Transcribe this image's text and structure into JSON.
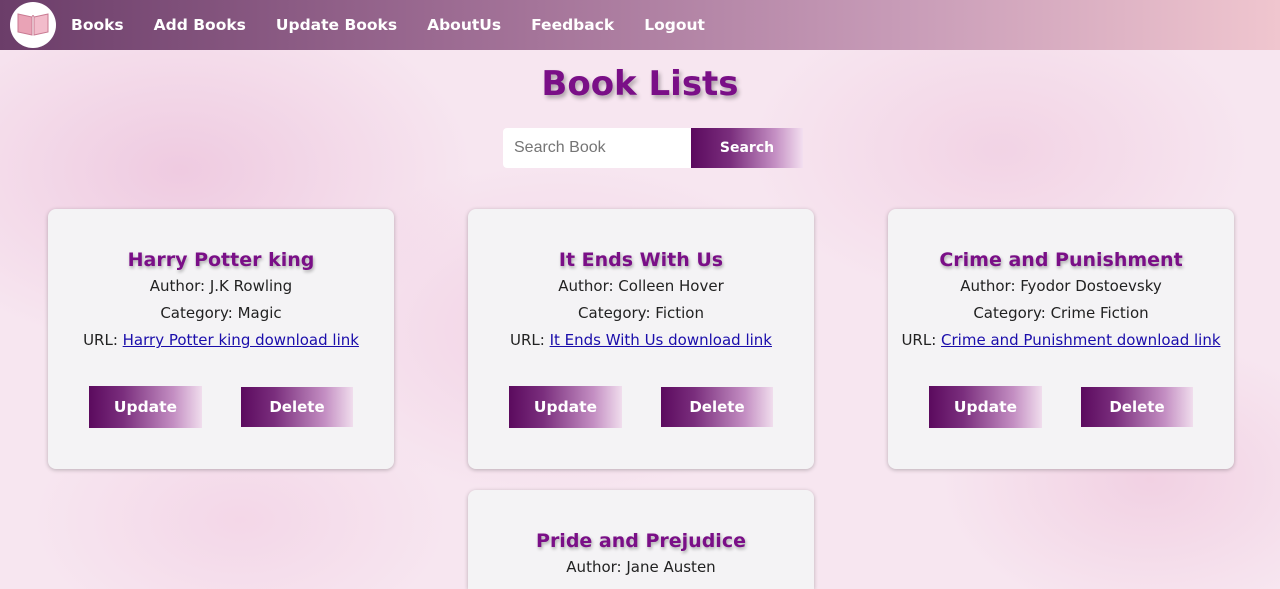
{
  "nav": {
    "logo_icon": "open-book-icon",
    "items": [
      {
        "label": "Books"
      },
      {
        "label": "Add Books"
      },
      {
        "label": "Update Books"
      },
      {
        "label": "AboutUs"
      },
      {
        "label": "Feedback"
      },
      {
        "label": "Logout"
      }
    ]
  },
  "page": {
    "title": "Book Lists"
  },
  "search": {
    "placeholder": "Search Book",
    "value": "",
    "button_label": "Search"
  },
  "labels": {
    "author": "Author: ",
    "category": "Category: ",
    "url": "URL: ",
    "update": "Update",
    "delete": "Delete"
  },
  "books": [
    {
      "title": "Harry Potter king",
      "author": "J.K Rowling",
      "category": "Magic",
      "link": "Harry Potter king download link"
    },
    {
      "title": "It Ends With Us",
      "author": "Colleen Hover",
      "category": "Fiction",
      "link": "It Ends With Us download link"
    },
    {
      "title": "Crime and Punishment",
      "author": "Fyodor Dostoevsky",
      "category": "Crime Fiction",
      "link": "Crime and Punishment download link"
    },
    {
      "title": "Pride and Prejudice",
      "author": "Jane Austen"
    }
  ],
  "colors": {
    "title": "#7a0f87",
    "button_dark": "#5b0a5e",
    "link": "#1a0dab",
    "card_bg": "#f4f3f5"
  }
}
